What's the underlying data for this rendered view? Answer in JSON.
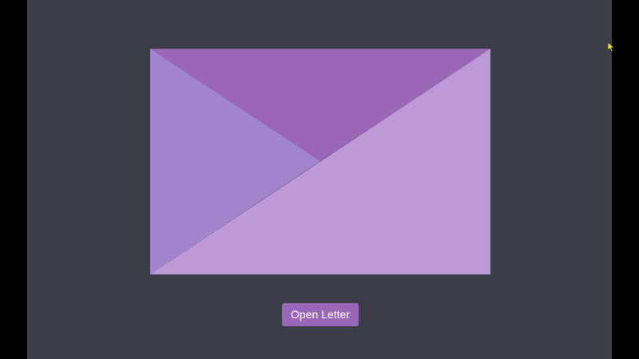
{
  "app": {
    "background_color": "#3b3e46",
    "letterbox_color": "#000000"
  },
  "envelope": {
    "colors": {
      "top_flap": "#9b66b8",
      "left_flap": "#a184cc",
      "body": "#bd9ad7"
    }
  },
  "actions": {
    "open_letter_label": "Open Letter",
    "button_color": "#9a67b8"
  },
  "cursor": {
    "icon": "mouse-pointer-icon",
    "color": "#f3e21a"
  }
}
